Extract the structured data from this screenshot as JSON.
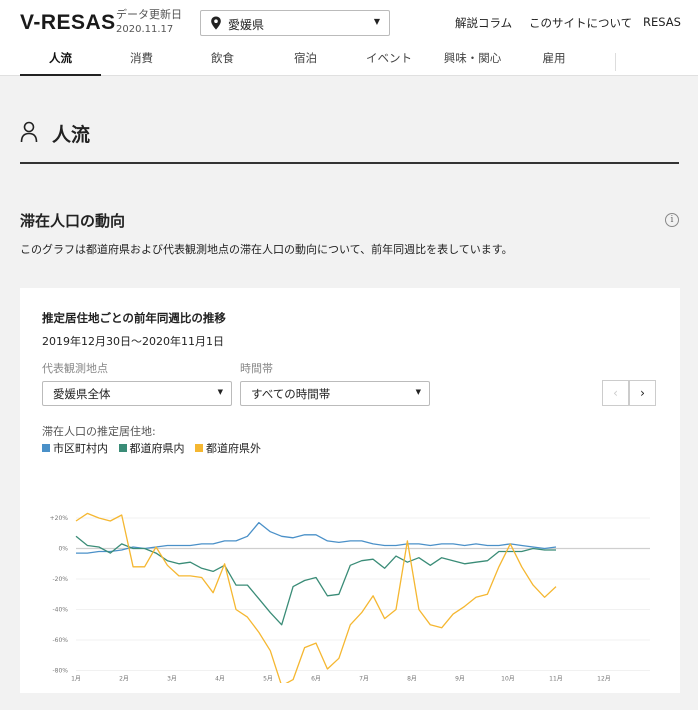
{
  "header": {
    "logo": "V-RESAS",
    "update_label": "データ更新日",
    "update_date": "2020.11.17",
    "prefecture": "愛媛県",
    "links": [
      "解説コラム",
      "このサイトについて",
      "RESAS"
    ]
  },
  "tabs": [
    "人流",
    "消費",
    "飲食",
    "宿泊",
    "イベント",
    "興味・関心",
    "雇用"
  ],
  "active_tab": "人流",
  "page": {
    "title": "人流",
    "section_title": "滞在人口の動向",
    "section_desc": "このグラフは都道府県および代表観測地点の滞在人口の動向について、前年同週比を表しています。"
  },
  "card": {
    "title": "推定居住地ごとの前年同週比の推移",
    "period": "2019年12月30日〜2020年11月1日",
    "point_label": "代表観測地点",
    "point_value": "愛媛県全体",
    "time_label": "時間帯",
    "time_value": "すべての時間帯",
    "prev_label": "‹",
    "next_label": "›",
    "legend_title": "滞在人口の推定居住地:"
  },
  "colors": {
    "series1": "#4a90c8",
    "series2": "#3a8c77",
    "series3": "#f5b731"
  },
  "chart_data": {
    "type": "line",
    "categories": [
      "1月",
      "2月",
      "3月",
      "4月",
      "5月",
      "6月",
      "7月",
      "8月",
      "9月",
      "10月",
      "11月",
      "12月"
    ],
    "yticks": [
      "+20%",
      "0%",
      "-20%",
      "-40%",
      "-60%",
      "-80%"
    ],
    "ylim": [
      -80,
      20
    ],
    "series": [
      {
        "name": "市区町村内",
        "color": "#4a90c8",
        "values": [
          -3,
          -3,
          -2,
          -2,
          -1,
          1,
          0,
          1,
          2,
          2,
          2,
          3,
          3,
          5,
          5,
          8,
          17,
          11,
          8,
          7,
          9,
          9,
          5,
          4,
          5,
          5,
          3,
          2,
          2,
          3,
          3,
          2,
          3,
          3,
          2,
          3,
          2,
          2,
          3,
          2,
          1,
          0,
          1
        ]
      },
      {
        "name": "都道府県内",
        "color": "#3a8c77",
        "values": [
          8,
          2,
          1,
          -3,
          3,
          0,
          0,
          -3,
          -8,
          -10,
          -9,
          -13,
          -15,
          -11,
          -24,
          -24,
          -33,
          -42,
          -50,
          -25,
          -21,
          -19,
          -31,
          -30,
          -11,
          -8,
          -7,
          -13,
          -5,
          -9,
          -6,
          -11,
          -6,
          -8,
          -10,
          -9,
          -8,
          -2,
          -2,
          -2,
          0,
          -1,
          -1
        ]
      },
      {
        "name": "都道府県外",
        "color": "#f5b731",
        "values": [
          18,
          23,
          20,
          18,
          22,
          -12,
          -12,
          1,
          -11,
          -18,
          -18,
          -19,
          -29,
          -10,
          -40,
          -45,
          -55,
          -67,
          -90,
          -86,
          -65,
          -62,
          -79,
          -72,
          -50,
          -42,
          -31,
          -46,
          -40,
          5,
          -40,
          -50,
          -52,
          -43,
          -38,
          -32,
          -30,
          -12,
          3,
          -12,
          -24,
          -32,
          -25
        ]
      }
    ],
    "xlabel": "",
    "ylabel": ""
  }
}
